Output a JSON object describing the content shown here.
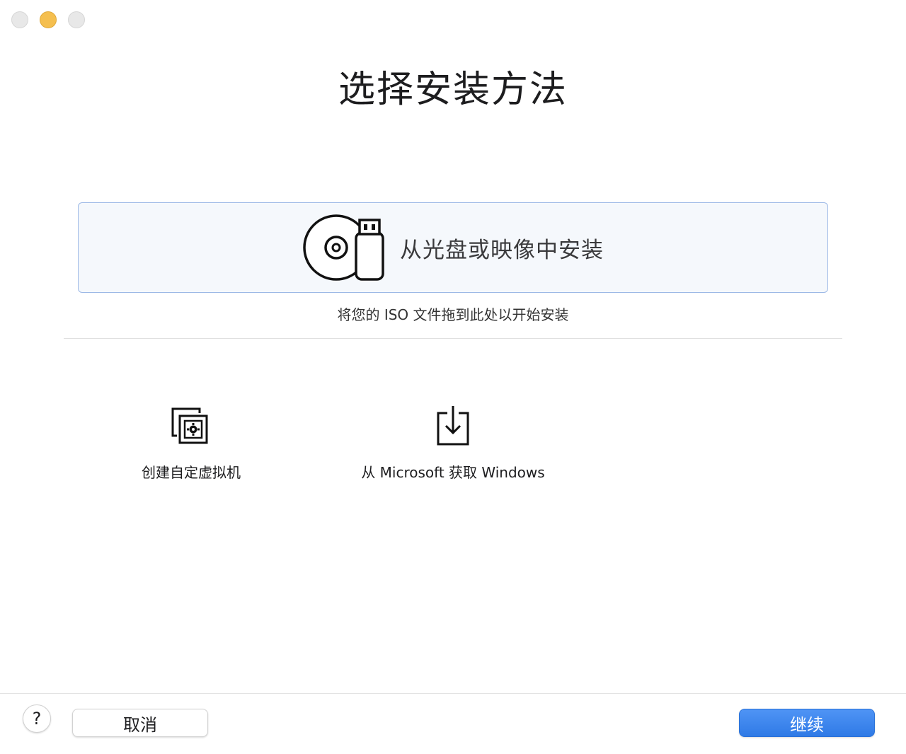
{
  "window": {
    "controls": [
      "close",
      "minimize",
      "zoom"
    ]
  },
  "title": "选择安装方法",
  "install_from_disc": {
    "label": "从光盘或映像中安装",
    "icon": "disc-usb-icon",
    "hint": "将您的 ISO 文件拖到此处以开始安装"
  },
  "options": [
    {
      "label": "创建自定虚拟机",
      "icon": "custom-vm-icon"
    },
    {
      "label": "从 Microsoft 获取 Windows",
      "icon": "download-icon"
    }
  ],
  "footer": {
    "help_label": "?",
    "cancel_label": "取消",
    "continue_label": "继续"
  },
  "colors": {
    "accent": "#3b82f0",
    "card_border": "#9db9e6",
    "card_background": "#f5f8fc",
    "minimize": "#f5bf4f"
  }
}
